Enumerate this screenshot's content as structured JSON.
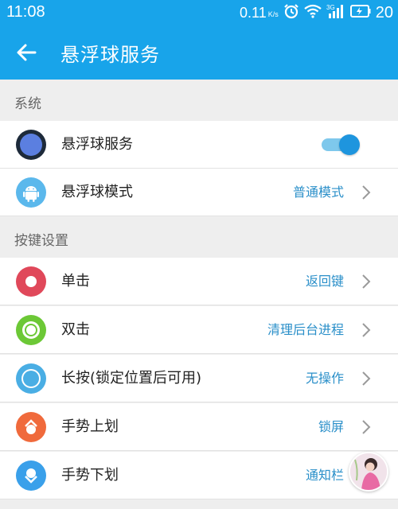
{
  "status_bar": {
    "time": "11:08",
    "net_speed": "0.11",
    "net_unit": "K/s",
    "network_type": "3G",
    "battery_level": "20"
  },
  "app_bar": {
    "title": "悬浮球服务"
  },
  "sections": {
    "system": "系统",
    "keys": "按键设置"
  },
  "system_items": {
    "service": {
      "label": "悬浮球服务",
      "toggle_on": true
    },
    "mode": {
      "label": "悬浮球模式",
      "value": "普通模式"
    }
  },
  "key_items": {
    "single": {
      "label": "单击",
      "value": "返回键"
    },
    "double": {
      "label": "双击",
      "value": "清理后台进程"
    },
    "long": {
      "label": "长按(锁定位置后可用)",
      "value": "无操作"
    },
    "swipe_up": {
      "label": "手势上划",
      "value": "锁屏"
    },
    "swipe_down": {
      "label": "手势下划",
      "value": "通知栏"
    }
  },
  "colors": {
    "primary": "#18a4ea",
    "value_text": "#2a8fc9",
    "icon_service": "#5b7fe0",
    "icon_mode": "#5bb8ec",
    "icon_single": "#e0485a",
    "icon_double": "#6cc836",
    "icon_long": "#4aaee4",
    "icon_swipe_up": "#f06a3c",
    "icon_swipe_down": "#3aa0ea"
  }
}
